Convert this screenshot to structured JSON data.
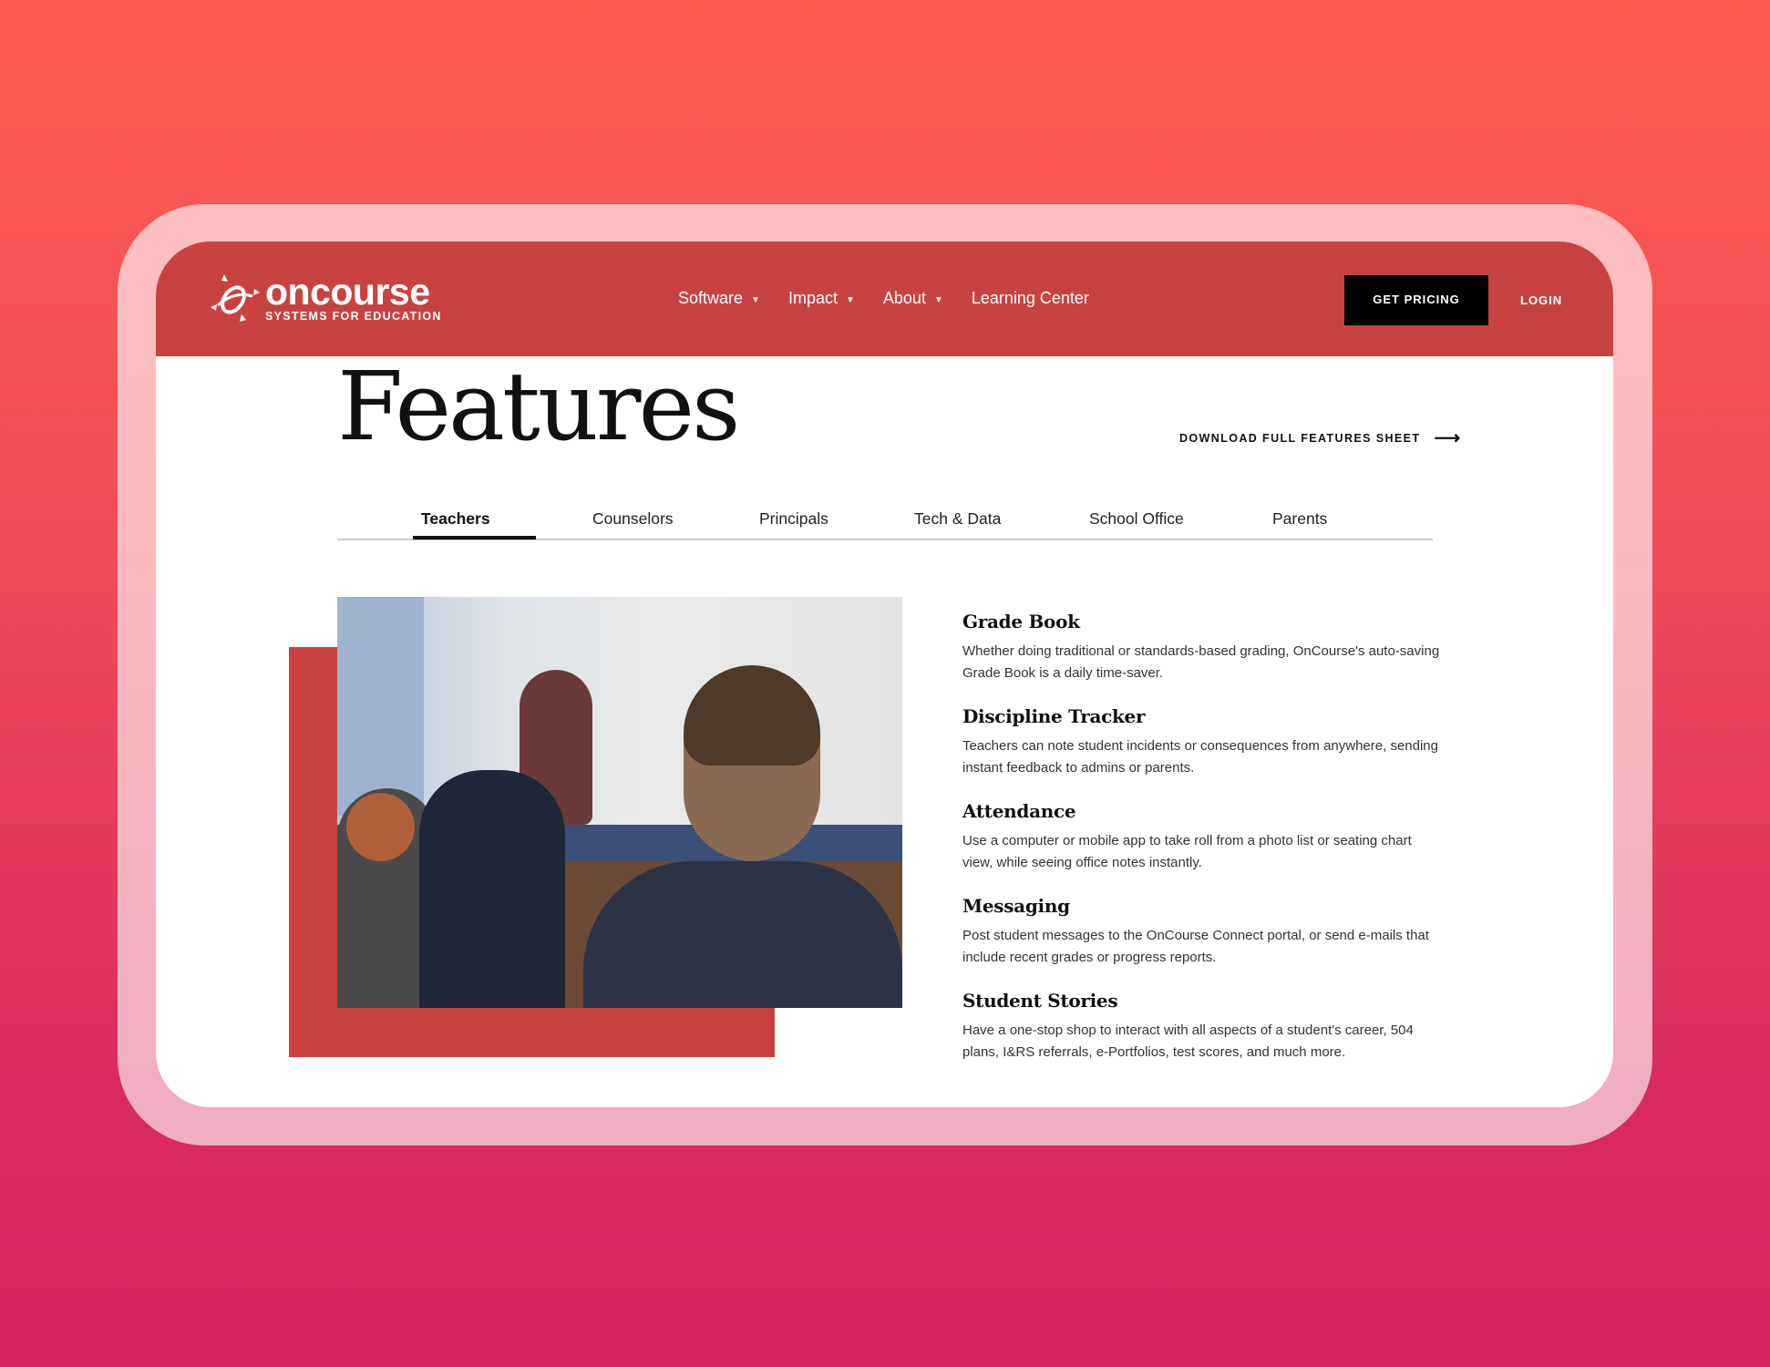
{
  "brand": {
    "name": "oncourse",
    "tagline": "SYSTEMS FOR EDUCATION",
    "color": "#c94242"
  },
  "nav": {
    "items": [
      {
        "label": "Software",
        "dropdown": true
      },
      {
        "label": "Impact",
        "dropdown": true
      },
      {
        "label": "About",
        "dropdown": true
      },
      {
        "label": "Learning Center",
        "dropdown": false
      }
    ],
    "caret": "▼"
  },
  "header": {
    "pricing_label": "GET PRICING",
    "login_label": "LOGIN"
  },
  "page": {
    "title": "Features",
    "download_label": "DOWNLOAD FULL FEATURES SHEET",
    "download_icon": "arrow-right-icon",
    "arrow": "⟶"
  },
  "tabs": [
    {
      "label": "Teachers",
      "active": true
    },
    {
      "label": "Counselors"
    },
    {
      "label": "Principals"
    },
    {
      "label": "Tech & Data"
    },
    {
      "label": "School Office"
    },
    {
      "label": "Parents"
    }
  ],
  "features": [
    {
      "title": "Grade Book",
      "text": "Whether doing traditional or standards-based grading, OnCourse's auto-saving Grade Book is a daily time-saver."
    },
    {
      "title": "Discipline Tracker",
      "text": "Teachers can note student incidents or consequences from anywhere, sending instant feedback to admins or parents."
    },
    {
      "title": "Attendance",
      "text": "Use a computer or mobile app to take roll from a photo list or seating chart view, while seeing office notes instantly."
    },
    {
      "title": "Messaging",
      "text": "Post student messages to the OnCourse Connect portal, or send e-mails that include recent grades or progress reports."
    },
    {
      "title": "Student Stories",
      "text": "Have a one-stop shop to interact with all aspects of a student's career, 504 plans, I&RS referrals, e-Portfolios, test scores, and much more."
    }
  ]
}
